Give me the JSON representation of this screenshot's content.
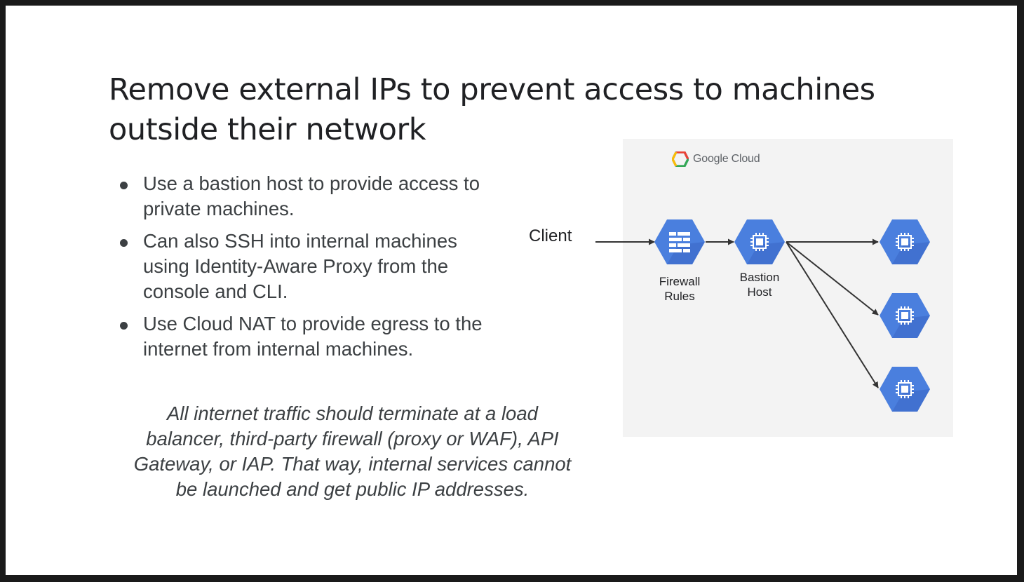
{
  "slide": {
    "title_line1": "Remove external IPs to prevent access to machines",
    "title_line2": "outside their network",
    "bullets": [
      {
        "line1": "Use a bastion host to provide access to",
        "line2": "private machines."
      },
      {
        "line1": "Can also SSH into internal machines",
        "line2": "using Identity-Aware Proxy from the",
        "line3": "console and CLI."
      },
      {
        "line1": "Use Cloud NAT to provide egress to the",
        "line2": "internet from internal machines."
      }
    ],
    "note_lines": [
      "All internet traffic should terminate at a load",
      "balancer, third-party firewall (proxy or WAF), API",
      "Gateway, or IAP. That way, internal services cannot",
      "be launched and get public IP addresses."
    ]
  },
  "diagram": {
    "logo_text": "Google Cloud",
    "client_label": "Client",
    "firewall_label_line1": "Firewall",
    "firewall_label_line2": "Rules",
    "bastion_label_line1": "Bastion",
    "bastion_label_line2": "Host",
    "node_color": "#4a7fde",
    "node_shadow_color": "#3a66c4",
    "arrow_color": "#333333",
    "panel_color": "#f3f3f3"
  }
}
